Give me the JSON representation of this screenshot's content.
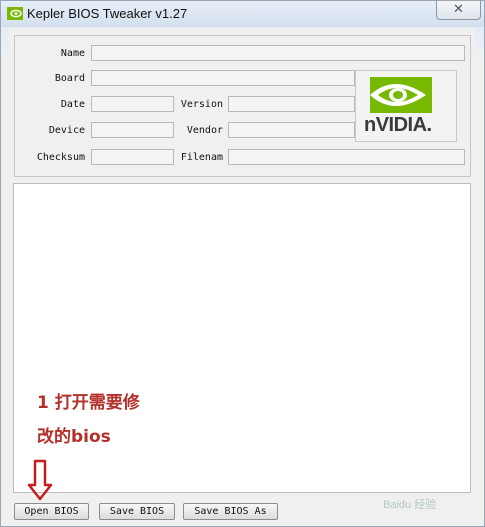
{
  "window": {
    "title": "Kepler BIOS Tweaker v1.27",
    "close_glyph": "✕"
  },
  "fields": {
    "name_label": "Name",
    "board_label": "Board",
    "date_label": "Date",
    "version_label": "Version",
    "device_label": "Device",
    "vendor_label": "Vendor",
    "checksum_label": "Checksum",
    "filename_label": "Filenam",
    "name_value": "",
    "board_value": "",
    "date_value": "",
    "version_value": "",
    "device_value": "",
    "vendor_value": "",
    "checksum_value": "",
    "filename_value": ""
  },
  "logo": {
    "text": "nVIDIA.",
    "brand_color": "#76b900"
  },
  "annotation": {
    "line1": "1 打开需要修",
    "line2": "改的bios",
    "color": "#b3302b"
  },
  "buttons": {
    "open": "Open BIOS",
    "save": "Save BIOS",
    "save_as": "Save BIOS As"
  },
  "watermark": {
    "text": "Baidu 经验"
  }
}
